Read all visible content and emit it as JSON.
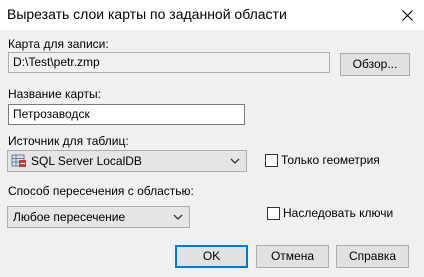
{
  "window": {
    "title": "Вырезать слои карты по заданной области",
    "close_icon": "close-icon"
  },
  "output_map": {
    "label": "Карта для записи:",
    "path": "D:\\Test\\petr.zmp",
    "browse_label": "Обзор..."
  },
  "map_name": {
    "label": "Название карты:",
    "value": "Петрозаводск"
  },
  "table_source": {
    "label": "Источник для таблиц:",
    "selected": "SQL Server LocalDB",
    "icon": "database-icon",
    "geometry_only_label": "Только геометрия",
    "geometry_only_checked": false
  },
  "intersection": {
    "label": "Способ пересечения с областью:",
    "selected": "Любое пересечение",
    "inherit_keys_label": "Наследовать ключи",
    "inherit_keys_checked": false
  },
  "buttons": {
    "ok": "OK",
    "cancel": "Отмена",
    "help": "Справка"
  },
  "colors": {
    "accent": "#0078d7",
    "background": "#f0f0f0"
  }
}
